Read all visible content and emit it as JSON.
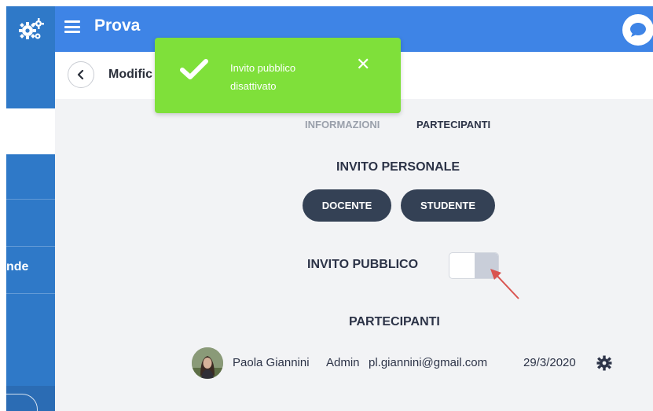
{
  "app": {
    "title": "Prova"
  },
  "sidebar": {
    "partial_item": "nde"
  },
  "header": {
    "title_partial": "Modific"
  },
  "toast": {
    "message": "Invito pubblico disattivato",
    "close_symbol": "✕",
    "color": "#7fe03a"
  },
  "tabs": [
    {
      "label": "INFORMAZIONI",
      "active": false
    },
    {
      "label": "PARTECIPANTI",
      "active": true
    }
  ],
  "personal_invite": {
    "title": "INVITO PERSONALE",
    "buttons": [
      "DOCENTE",
      "STUDENTE"
    ]
  },
  "public_invite": {
    "title": "INVITO PUBBLICO",
    "enabled": false
  },
  "participants": {
    "title": "PARTECIPANTI",
    "rows": [
      {
        "name": "Paola Giannini",
        "role": "Admin",
        "email": "pl.giannini@gmail.com",
        "date": "29/3/2020"
      }
    ]
  },
  "icons": [
    "gears-icon",
    "menu-icon",
    "chat-icon",
    "back-chevron-icon",
    "check-icon",
    "close-icon",
    "avatar",
    "gear-icon",
    "red-arrow"
  ],
  "colors": {
    "primary": "#3e84e6",
    "sidebar": "#2f79c8",
    "dark_button": "#344155",
    "arrow": "#d9534f"
  }
}
